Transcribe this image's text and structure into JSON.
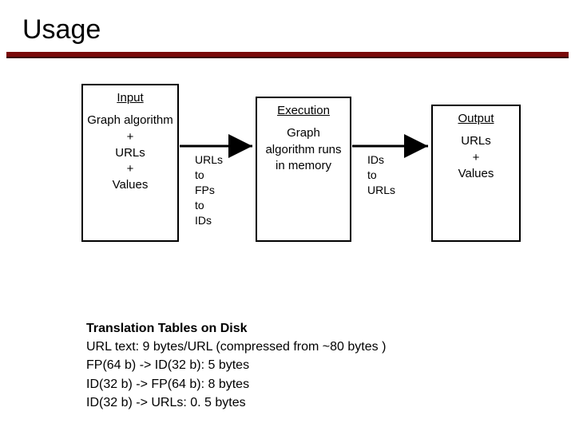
{
  "title": "Usage",
  "diagram": {
    "input": {
      "header": "Input",
      "body": "Graph algorithm\n+\nURLs\n+\nValues"
    },
    "execution": {
      "header": "Execution",
      "body": "Graph algorithm runs in memory"
    },
    "output": {
      "header": "Output",
      "body": "URLs\n+\nValues"
    },
    "arrow1": "URLs\nto\nFPs\nto\nIDs",
    "arrow2": "IDs\nto\nURLs"
  },
  "notes": {
    "heading": "Translation Tables on Disk",
    "lines": [
      "URL text: 9 bytes/URL (compressed from ~80 bytes )",
      "FP(64 b) -> ID(32 b): 5 bytes",
      "ID(32 b) -> FP(64 b): 8 bytes",
      "ID(32 b) -> URLs: 0. 5 bytes"
    ]
  }
}
